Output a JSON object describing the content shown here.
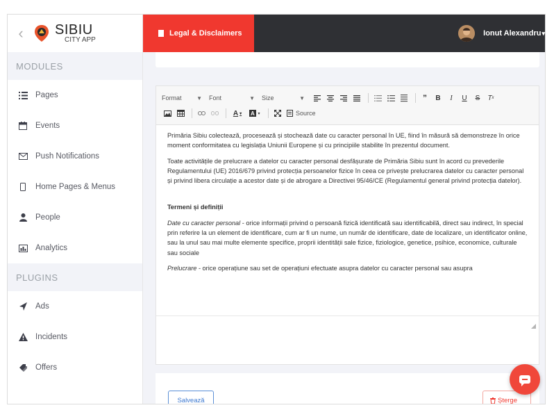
{
  "brand": {
    "name": "SIBIU",
    "subtitle": "CITY APP"
  },
  "sidebar": {
    "modules_label": "MODULES",
    "modules": [
      {
        "label": "Pages",
        "icon": "list-icon"
      },
      {
        "label": "Events",
        "icon": "calendar-icon"
      },
      {
        "label": "Push Notifications",
        "icon": "envelope-icon"
      },
      {
        "label": "Home Pages & Menus",
        "icon": "mobile-icon"
      },
      {
        "label": "People",
        "icon": "user-icon"
      },
      {
        "label": "Analytics",
        "icon": "chart-icon"
      }
    ],
    "plugins_label": "PLUGINS",
    "plugins": [
      {
        "label": "Ads",
        "icon": "megaphone-icon"
      },
      {
        "label": "Incidents",
        "icon": "warning-icon"
      },
      {
        "label": "Offers",
        "icon": "tags-icon"
      }
    ]
  },
  "topbar": {
    "tab_label": "Legal & Disclaimers",
    "user_name": "Ionut Alexandru",
    "user_caret": "▾"
  },
  "toolbar": {
    "format": "Format",
    "font": "Font",
    "size": "Size",
    "source": "Source"
  },
  "editor": {
    "p1": "Primăria Sibiu colectează, procesează și stochează date cu caracter personal în UE, fiind în măsură să demonstreze în orice moment conformitatea cu legislația Uniunii Europene și cu principiile stabilite în prezentul document.",
    "p2": "Toate activitățile de prelucrare a datelor cu caracter personal desfășurate de Primăria Sibiu sunt în acord cu prevederile Regulamentului (UE) 2016/679 privind protecția persoanelor fizice în ceea ce privește prelucrarea datelor cu caracter personal și privind libera circulație a acestor date și de abrogare a Directivei 95/46/CE (Regulamentul general privind protecția datelor).",
    "heading": "Termeni și definiții",
    "def1_term": "Date cu caracter personal",
    "def1_text": " - orice informații privind o persoană fizică identificată sau identificabilă, direct sau indirect, în special prin referire la un element de identificare, cum ar fi un nume, un număr de identificare, date de localizare, un identificator online, sau la unul sau mai multe elemente specifice, proprii identității sale fizice, fiziologice, genetice, psihice, economice, culturale sau sociale",
    "def2_term": "Prelucrare",
    "def2_text": " - orice operațiune sau set de operațiuni efectuate asupra datelor cu caracter personal sau asupra"
  },
  "actions": {
    "save": "Salvează",
    "delete": "Șterge"
  },
  "colors": {
    "accent": "#f0382f",
    "topbar": "#2f3034",
    "save": "#3b78d0"
  }
}
